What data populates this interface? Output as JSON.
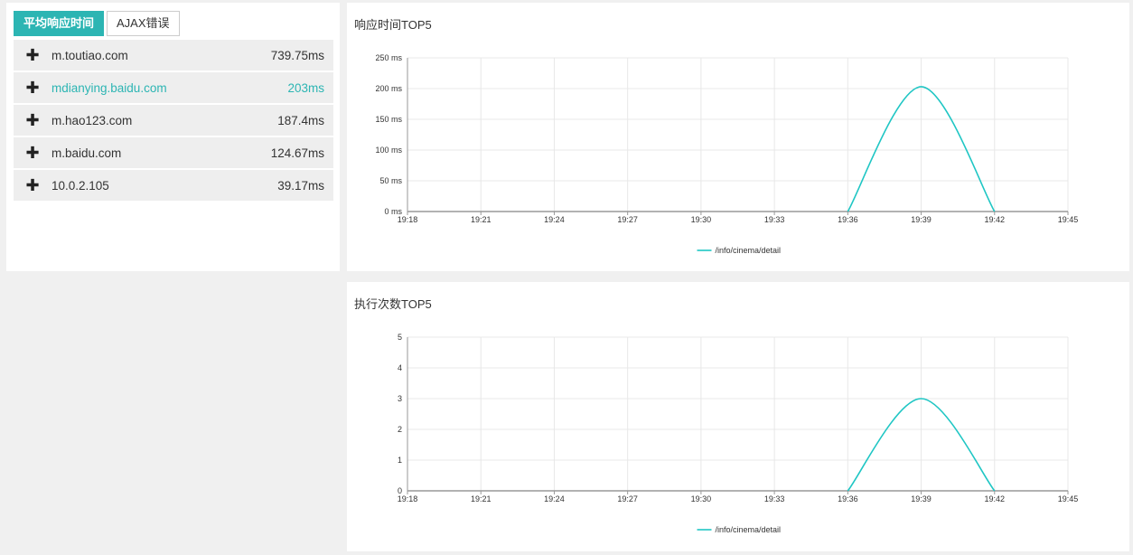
{
  "tabs": [
    {
      "label": "平均响应时间",
      "active": true
    },
    {
      "label": "AJAX错误",
      "active": false
    }
  ],
  "domains": [
    {
      "name": "m.toutiao.com",
      "value": "739.75ms",
      "highlight": false
    },
    {
      "name": "mdianying.baidu.com",
      "value": "203ms",
      "highlight": true
    },
    {
      "name": "m.hao123.com",
      "value": "187.4ms",
      "highlight": false
    },
    {
      "name": "m.baidu.com",
      "value": "124.67ms",
      "highlight": false
    },
    {
      "name": "10.0.2.105",
      "value": "39.17ms",
      "highlight": false
    }
  ],
  "colors": {
    "accent": "#2cb5b3",
    "line": "#1fc6c4",
    "grid": "#e8e8e8",
    "axis": "#999999"
  },
  "chart_data": [
    {
      "type": "line",
      "title": "响应时间TOP5",
      "x": [
        "19:18",
        "19:21",
        "19:24",
        "19:27",
        "19:30",
        "19:33",
        "19:36",
        "19:39",
        "19:42",
        "19:45"
      ],
      "yticks": [
        "0 ms",
        "50 ms",
        "100 ms",
        "150 ms",
        "200 ms",
        "250 ms"
      ],
      "ylim": [
        0,
        250
      ],
      "series": [
        {
          "name": "/info/cinema/detail",
          "points": [
            [
              "19:36",
              0
            ],
            [
              "19:39",
              203
            ],
            [
              "19:42",
              0
            ]
          ]
        }
      ],
      "legend": "bottom-center",
      "grid": true
    },
    {
      "type": "line",
      "title": "执行次数TOP5",
      "x": [
        "19:18",
        "19:21",
        "19:24",
        "19:27",
        "19:30",
        "19:33",
        "19:36",
        "19:39",
        "19:42",
        "19:45"
      ],
      "yticks": [
        "0",
        "1",
        "2",
        "3",
        "4",
        "5"
      ],
      "ylim": [
        0,
        5
      ],
      "series": [
        {
          "name": "/info/cinema/detail",
          "points": [
            [
              "19:36",
              0
            ],
            [
              "19:39",
              3
            ],
            [
              "19:42",
              0
            ]
          ]
        }
      ],
      "legend": "bottom-center",
      "grid": true
    }
  ]
}
